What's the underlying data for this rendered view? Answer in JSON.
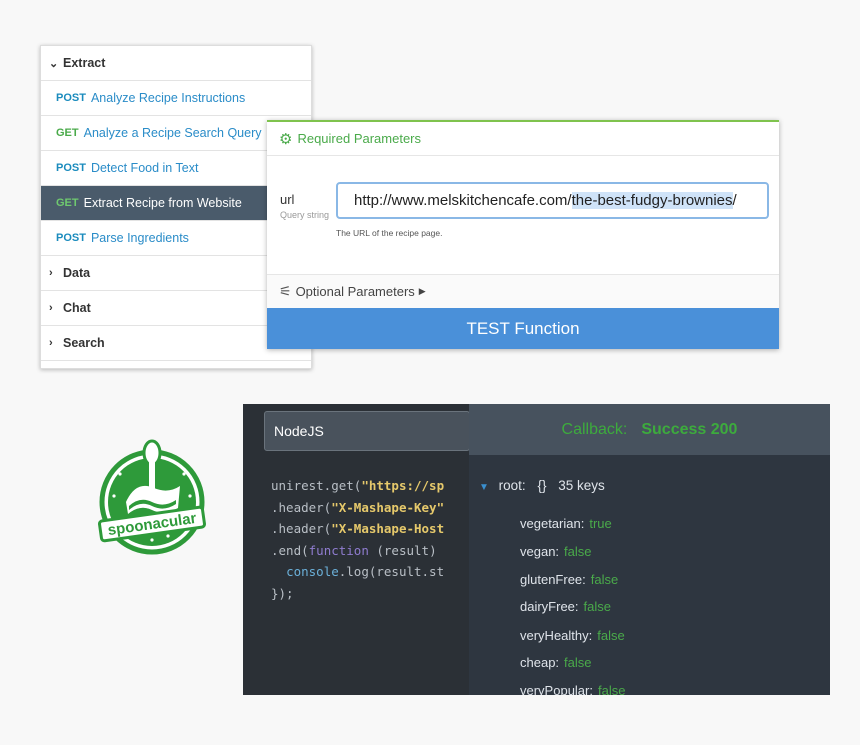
{
  "sidebar": {
    "groups": [
      {
        "label": "Extract",
        "expanded": true
      },
      {
        "label": "Data",
        "expanded": false
      },
      {
        "label": "Chat",
        "expanded": false
      },
      {
        "label": "Search",
        "expanded": false
      }
    ],
    "endpoints": [
      {
        "method": "POST",
        "label": "Analyze Recipe Instructions"
      },
      {
        "method": "GET",
        "label": "Analyze a Recipe Search Query"
      },
      {
        "method": "POST",
        "label": "Detect Food in Text"
      },
      {
        "method": "GET",
        "label": "Extract Recipe from Website",
        "active": true
      },
      {
        "method": "POST",
        "label": "Parse Ingredients"
      }
    ]
  },
  "params": {
    "required_title": "Required Parameters",
    "param_name": "url",
    "param_type": "Query string",
    "url_prefix": "http://www.melskitchencafe.com/",
    "url_selected": "the-best-fudgy-brownies",
    "url_suffix": "/",
    "param_desc": "The URL of the recipe page.",
    "optional_title": "Optional Parameters",
    "test_button": "TEST Function"
  },
  "logo": {
    "text": "spoonacular"
  },
  "editor": {
    "language": "NodeJS",
    "code": {
      "l1_a": "unirest.get(",
      "l1_s": "\"https://sp",
      "l2_a": ".header(",
      "l2_s": "\"X-Mashape-Key\"",
      "l3_a": ".header(",
      "l3_s": "\"X-Mashape-Host",
      "l4_a": ".end(",
      "l4_k": "function",
      "l4_b": " (result)",
      "l5_f": "console",
      "l5_b": ".log(result.st",
      "l6": "});"
    }
  },
  "callback": {
    "label": "Callback:",
    "status": "Success 200",
    "root_label": "root:",
    "root_brace": "{}",
    "root_keys": "35 keys",
    "fields": [
      {
        "key": "vegetarian:",
        "value": "true"
      },
      {
        "key": "vegan:",
        "value": "false"
      },
      {
        "key": "glutenFree:",
        "value": "false"
      },
      {
        "key": "dairyFree:",
        "value": "false"
      },
      {
        "key": "veryHealthy:",
        "value": "false"
      },
      {
        "key": "cheap:",
        "value": "false"
      },
      {
        "key": "veryPopular:",
        "value": "false"
      }
    ]
  },
  "colors": {
    "accent_green": "#4aaa4a",
    "accent_blue": "#4a90d9",
    "active_row": "#4a5b6b"
  }
}
